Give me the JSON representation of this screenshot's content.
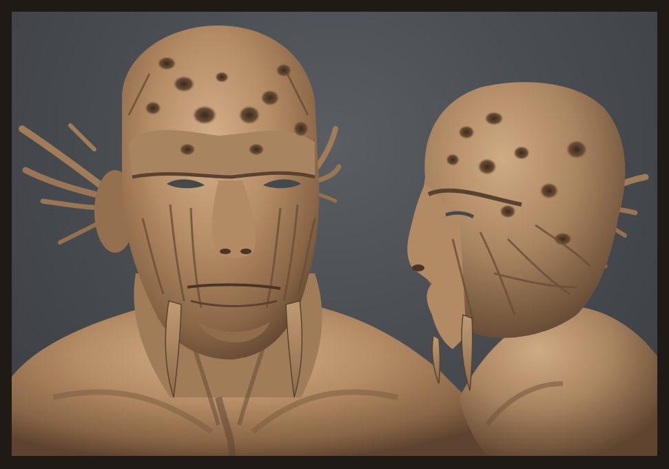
{
  "scene": {
    "subject": "sculpted-creature-bust",
    "views": [
      "front-view",
      "three-quarter-view"
    ],
    "colors": {
      "frame": "#1f1a16",
      "background": "#4a4e52",
      "clay_light": "#c9a47c",
      "clay_mid": "#a9845e",
      "clay_shadow": "#6e5238",
      "clay_deep": "#3f2d1f"
    }
  }
}
